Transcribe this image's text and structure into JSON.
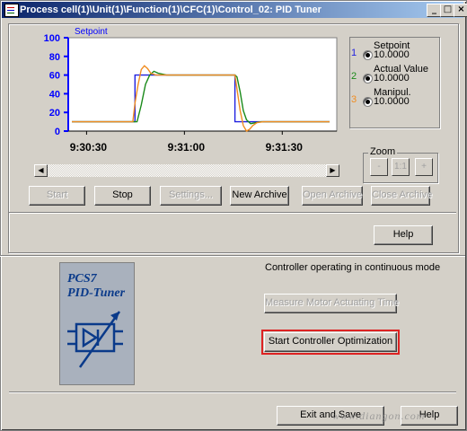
{
  "window": {
    "title": "Process cell(1)\\Unit(1)\\Function(1)\\CFC(1)\\Control_02: PID Tuner",
    "controls": [
      "_",
      "□",
      "×"
    ]
  },
  "chart_data": {
    "type": "line",
    "title": "Setpoint",
    "xlabel": "",
    "ylabel": "",
    "ylim": [
      0,
      100
    ],
    "yticks": [
      "100",
      "80",
      "60",
      "40",
      "20",
      "0"
    ],
    "xtick_labels": [
      "9:30:30",
      "9:31:00",
      "9:31:30"
    ],
    "series": [
      {
        "name": "Setpoint",
        "color": "#2020e0",
        "x": [
          0,
          60,
          60,
          155,
          155,
          245
        ],
        "values": [
          10,
          10,
          60,
          60,
          10,
          10
        ]
      },
      {
        "name": "Actual Value",
        "color": "#1a8a1a",
        "x": [
          0,
          62,
          66,
          70,
          74,
          78,
          82,
          90,
          100,
          155,
          157,
          160,
          163,
          166,
          170,
          175,
          180,
          190,
          245
        ],
        "values": [
          10,
          10,
          28,
          50,
          60,
          64,
          62,
          60,
          60,
          60,
          58,
          42,
          22,
          12,
          8,
          9,
          10,
          10,
          10
        ]
      },
      {
        "name": "Manipul.",
        "color": "#f08c20",
        "x": [
          0,
          58,
          60,
          63,
          66,
          69,
          72,
          75,
          80,
          90,
          155,
          157,
          160,
          163,
          166,
          169,
          172,
          176,
          182,
          245
        ],
        "values": [
          10,
          10,
          30,
          50,
          66,
          70,
          67,
          62,
          60,
          60,
          60,
          45,
          22,
          6,
          0,
          2,
          6,
          9,
          10,
          10
        ]
      }
    ]
  },
  "legend": [
    {
      "index": "1",
      "label": "Setpoint",
      "value": "10.0000",
      "color": "#2020e0"
    },
    {
      "index": "2",
      "label": "Actual Value",
      "value": "10.0000",
      "color": "#1a8a1a"
    },
    {
      "index": "3",
      "label": "Manipul.",
      "value": "10.0000",
      "color": "#f08c20"
    }
  ],
  "zoom": {
    "label": "Zoom",
    "buttons": [
      "-",
      "1:1",
      "+"
    ]
  },
  "buttons": {
    "start": "Start",
    "stop": "Stop",
    "settings": "Settings...",
    "new_archive": "New Archive",
    "open_archive": "Open Archive",
    "close_archive": "Close Archive",
    "help_top": "Help",
    "measure": "Measure Motor Actuating Time",
    "optimize": "Start Controller Optimization",
    "exit_save": "Exit and Save",
    "help_bottom": "Help"
  },
  "status_text": "Controller operating in continuous mode",
  "logo": {
    "line1": "PCS7",
    "line2": "PID-Tuner"
  },
  "watermark": "www.diangon.com"
}
